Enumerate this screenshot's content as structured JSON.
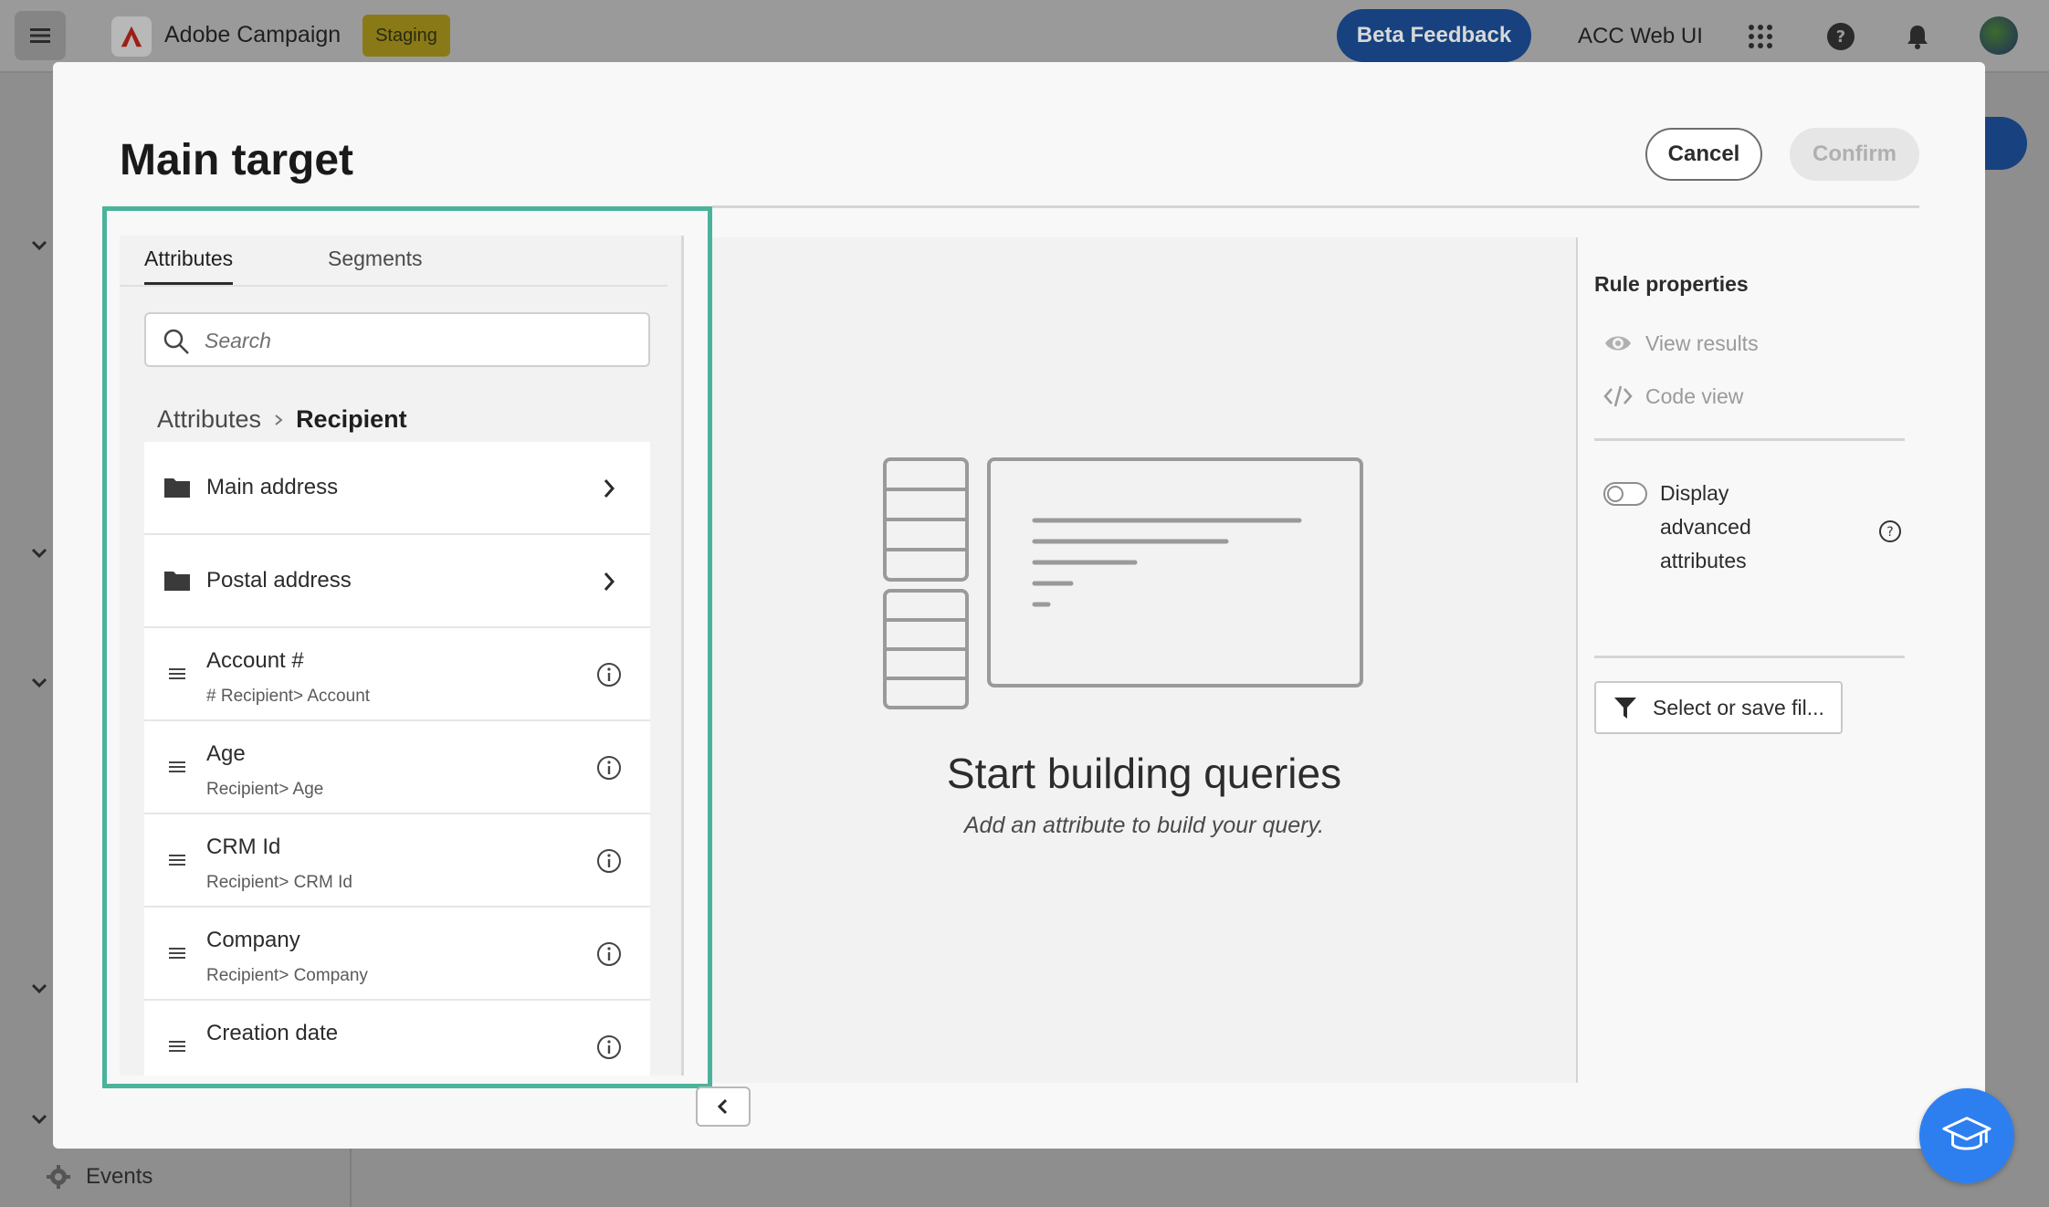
{
  "app": {
    "brand_name": "Adobe Campaign",
    "env_badge": "Staging",
    "beta_feedback": "Beta Feedback",
    "env_label": "ACC Web UI",
    "sidebar_last_item": "Events"
  },
  "modal": {
    "title": "Main target",
    "cancel_label": "Cancel",
    "confirm_label": "Confirm"
  },
  "left_panel": {
    "tabs": [
      {
        "label": "Attributes",
        "active": true
      },
      {
        "label": "Segments",
        "active": false
      }
    ],
    "search_placeholder": "Search",
    "breadcrumb": {
      "root": "Attributes",
      "current": "Recipient"
    },
    "items": [
      {
        "name": "Main address",
        "type": "folder"
      },
      {
        "name": "Postal address",
        "type": "folder"
      },
      {
        "name": "Account #",
        "path": "# Recipient> Account",
        "type": "field"
      },
      {
        "name": "Age",
        "path": "Recipient> Age",
        "type": "field"
      },
      {
        "name": "CRM Id",
        "path": "Recipient> CRM Id",
        "type": "field"
      },
      {
        "name": "Company",
        "path": "Recipient> Company",
        "type": "field"
      },
      {
        "name": "Creation date",
        "path": "",
        "type": "field"
      }
    ]
  },
  "canvas": {
    "empty_title": "Start building queries",
    "empty_subtitle": "Add an attribute to build your query."
  },
  "right_panel": {
    "title": "Rule properties",
    "view_results": "View results",
    "code_view": "Code view",
    "advanced_toggle_label": "Display advanced attributes",
    "advanced_toggle_on": false,
    "filter_button": "Select or save fil..."
  },
  "colors": {
    "highlight": "#4bb39a",
    "beta_button": "#17427f",
    "help_fab": "#2d7ff0",
    "staging_badge": "#8a7a17"
  }
}
